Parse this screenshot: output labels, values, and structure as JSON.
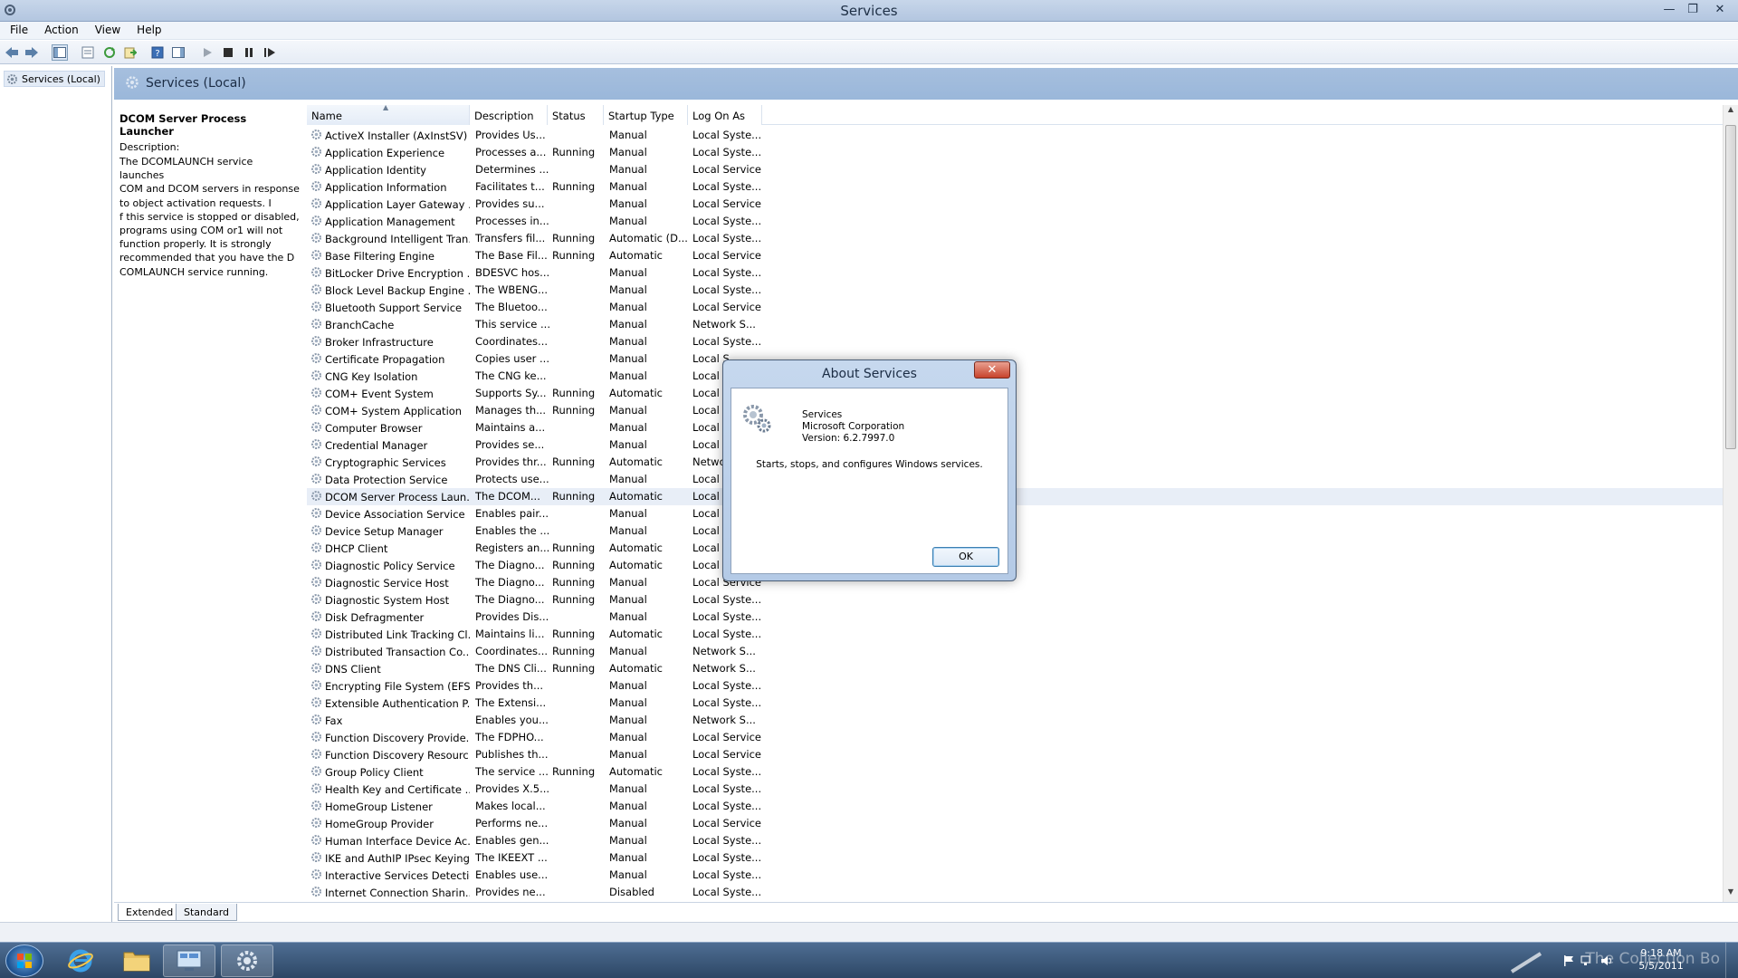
{
  "window": {
    "title": "Services",
    "minimize": "—",
    "maximize": "❐",
    "close": "✕"
  },
  "menu": [
    "File",
    "Action",
    "View",
    "Help"
  ],
  "toolbar": [
    "back-icon",
    "forward-icon",
    "show-hide-tree-icon",
    "properties-icon",
    "refresh-icon",
    "export-list-icon",
    "help-icon",
    "show-hide-action-pane-icon",
    "start-service-icon",
    "stop-service-icon",
    "pause-service-icon",
    "restart-service-icon"
  ],
  "tree": {
    "item": "Services (Local)"
  },
  "pane": {
    "title": "Services (Local)"
  },
  "details": {
    "title": "DCOM Server Process Launcher",
    "label": "Description:",
    "body": "The DCOMLAUNCH service launches\nCOM and DCOM servers in response\nto object activation requests. I\nf this service is stopped or disabled,\nprograms using COM or1 will not\nfunction properly. It is strongly\nrecommended that you have the D\nCOMLAUNCH service running."
  },
  "columns": {
    "name": "Name",
    "description": "Description",
    "status": "Status",
    "startup": "Startup Type",
    "logon": "Log On As"
  },
  "services": [
    [
      "ActiveX Installer (AxInstSV)",
      "Provides Us...",
      "",
      "Manual",
      "Local Syste..."
    ],
    [
      "Application Experience",
      "Processes a...",
      "Running",
      "Manual",
      "Local Syste..."
    ],
    [
      "Application Identity",
      "Determines ...",
      "",
      "Manual",
      "Local Service"
    ],
    [
      "Application Information",
      "Facilitates t...",
      "Running",
      "Manual",
      "Local Syste..."
    ],
    [
      "Application Layer Gateway ...",
      "Provides su...",
      "",
      "Manual",
      "Local Service"
    ],
    [
      "Application Management",
      "Processes in...",
      "",
      "Manual",
      "Local Syste..."
    ],
    [
      "Background Intelligent Tran...",
      "Transfers fil...",
      "Running",
      "Automatic (D...",
      "Local Syste..."
    ],
    [
      "Base Filtering Engine",
      "The Base Fil...",
      "Running",
      "Automatic",
      "Local Service"
    ],
    [
      "BitLocker Drive Encryption ...",
      "BDESVC hos...",
      "",
      "Manual",
      "Local Syste..."
    ],
    [
      "Block Level Backup Engine ...",
      "The WBENG...",
      "",
      "Manual",
      "Local Syste..."
    ],
    [
      "Bluetooth Support Service",
      "The Bluetoo...",
      "",
      "Manual",
      "Local Service"
    ],
    [
      "BranchCache",
      "This service ...",
      "",
      "Manual",
      "Network S..."
    ],
    [
      "Broker Infrastructure",
      "Coordinates...",
      "",
      "Manual",
      "Local Syste..."
    ],
    [
      "Certificate Propagation",
      "Copies user ...",
      "",
      "Manual",
      "Local S"
    ],
    [
      "CNG Key Isolation",
      "The CNG ke...",
      "",
      "Manual",
      "Local"
    ],
    [
      "COM+ Event System",
      "Supports Sy...",
      "Running",
      "Automatic",
      "Local"
    ],
    [
      "COM+ System Application",
      "Manages th...",
      "Running",
      "Manual",
      "Local"
    ],
    [
      "Computer Browser",
      "Maintains a...",
      "",
      "Manual",
      "Local"
    ],
    [
      "Credential Manager",
      "Provides se...",
      "",
      "Manual",
      "Local"
    ],
    [
      "Cryptographic Services",
      "Provides thr...",
      "Running",
      "Automatic",
      "Netwo"
    ],
    [
      "Data Protection Service",
      "Protects use...",
      "",
      "Manual",
      "Local"
    ],
    [
      "DCOM Server Process Laun...",
      "The DCOM...",
      "Running",
      "Automatic",
      "Local"
    ],
    [
      "Device Association Service",
      "Enables pair...",
      "",
      "Manual",
      "Local"
    ],
    [
      "Device Setup Manager",
      "Enables the ...",
      "",
      "Manual",
      "Local"
    ],
    [
      "DHCP Client",
      "Registers an...",
      "Running",
      "Automatic",
      "Local"
    ],
    [
      "Diagnostic Policy Service",
      "The Diagno...",
      "Running",
      "Automatic",
      "Local"
    ],
    [
      "Diagnostic Service Host",
      "The Diagno...",
      "Running",
      "Manual",
      "Local Service"
    ],
    [
      "Diagnostic System Host",
      "The Diagno...",
      "Running",
      "Manual",
      "Local Syste..."
    ],
    [
      "Disk Defragmenter",
      "Provides Dis...",
      "",
      "Manual",
      "Local Syste..."
    ],
    [
      "Distributed Link Tracking Cl...",
      "Maintains li...",
      "Running",
      "Automatic",
      "Local Syste..."
    ],
    [
      "Distributed Transaction Co...",
      "Coordinates...",
      "Running",
      "Manual",
      "Network S..."
    ],
    [
      "DNS Client",
      "The DNS Cli...",
      "Running",
      "Automatic",
      "Network S..."
    ],
    [
      "Encrypting File System (EFS)",
      "Provides th...",
      "",
      "Manual",
      "Local Syste..."
    ],
    [
      "Extensible Authentication P...",
      "The Extensi...",
      "",
      "Manual",
      "Local Syste..."
    ],
    [
      "Fax",
      "Enables you...",
      "",
      "Manual",
      "Network S..."
    ],
    [
      "Function Discovery Provide...",
      "The FDPHO...",
      "",
      "Manual",
      "Local Service"
    ],
    [
      "Function Discovery Resourc...",
      "Publishes th...",
      "",
      "Manual",
      "Local Service"
    ],
    [
      "Group Policy Client",
      "The service ...",
      "Running",
      "Automatic",
      "Local Syste..."
    ],
    [
      "Health Key and Certificate ...",
      "Provides X.5...",
      "",
      "Manual",
      "Local Syste..."
    ],
    [
      "HomeGroup Listener",
      "Makes local...",
      "",
      "Manual",
      "Local Syste..."
    ],
    [
      "HomeGroup Provider",
      "Performs ne...",
      "",
      "Manual",
      "Local Service"
    ],
    [
      "Human Interface Device Ac...",
      "Enables gen...",
      "",
      "Manual",
      "Local Syste..."
    ],
    [
      "IKE and AuthIP IPsec Keying...",
      "The IKEEXT ...",
      "",
      "Manual",
      "Local Syste..."
    ],
    [
      "Interactive Services Detection",
      "Enables use...",
      "",
      "Manual",
      "Local Syste..."
    ],
    [
      "Internet Connection Sharin...",
      "Provides ne...",
      "",
      "Disabled",
      "Local Syste..."
    ]
  ],
  "tabs": {
    "extended": "Extended",
    "standard": "Standard"
  },
  "dialog": {
    "title": "About Services",
    "close": "✕",
    "product": "Services",
    "company": "Microsoft Corporation",
    "version": "Version: 6.2.7997.0",
    "blurb": "Starts, stops, and configures Windows services.",
    "ok": "OK"
  },
  "taskbar": {
    "time": "9:18 AM",
    "date": "5/5/2011",
    "watermark": "The Collection Bo"
  }
}
